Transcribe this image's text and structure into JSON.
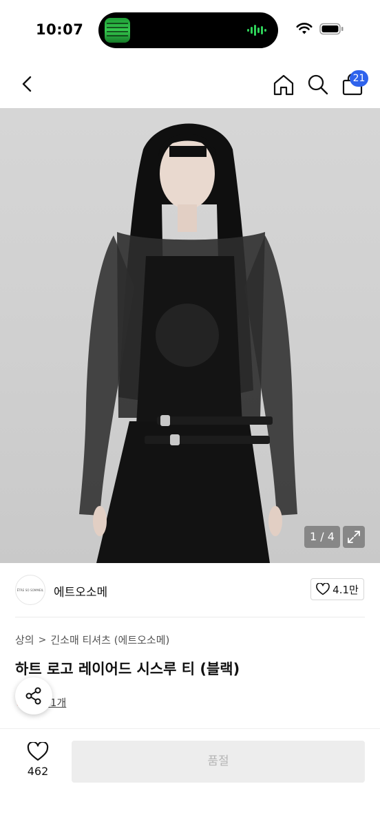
{
  "status_bar": {
    "time": "10:07",
    "icons": [
      "wifi-icon",
      "battery-icon"
    ]
  },
  "nav": {
    "back_icon": "chevron-left-icon",
    "home_icon": "home-icon",
    "search_icon": "search-icon",
    "bag_icon": "shopping-bag-icon",
    "bag_badge": "21",
    "accent_color": "#2f63ec"
  },
  "gallery": {
    "counter": "1 / 4",
    "expand_icon": "expand-icon"
  },
  "seller": {
    "logo_text": "ÊTRE SO SOMMEIL",
    "name": "에트오소메",
    "likes": "4.1만"
  },
  "product": {
    "breadcrumb": [
      "상의",
      "긴소매 티셔츠 (에트오소메)"
    ],
    "title": "하트 로고 레이어드 시스루 티 (블랙)",
    "review_link": "후기 1개"
  },
  "bottom_bar": {
    "wish_count": "462",
    "buy_button_label": "품절"
  }
}
